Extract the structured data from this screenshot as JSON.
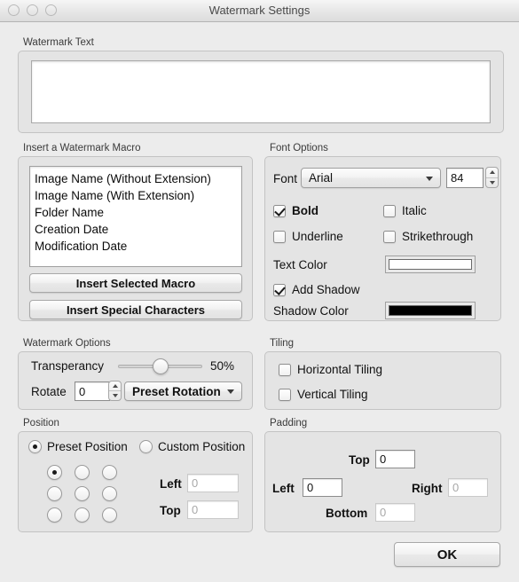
{
  "window": {
    "title": "Watermark Settings",
    "traffic_lights": [
      "close",
      "minimize",
      "zoom"
    ]
  },
  "watermark_text": {
    "label": "Watermark Text",
    "value": "",
    "placeholder": ""
  },
  "macro": {
    "group_label": "Insert a Watermark Macro",
    "items": [
      "Image Name (Without Extension)",
      "Image Name (With Extension)",
      "Folder Name",
      "Creation Date",
      "Modification Date"
    ],
    "insert_selected_label": "Insert Selected Macro",
    "insert_special_label": "Insert Special Characters"
  },
  "font_options": {
    "group_label": "Font Options",
    "font_label": "Font",
    "font_value": "Arial",
    "size_value": "84",
    "bold": {
      "label": "Bold",
      "checked": true
    },
    "italic": {
      "label": "Italic",
      "checked": false
    },
    "underline": {
      "label": "Underline",
      "checked": false
    },
    "strikethrough": {
      "label": "Strikethrough",
      "checked": false
    },
    "text_color_label": "Text Color",
    "text_color_value": "#ffffff",
    "add_shadow": {
      "label": "Add Shadow",
      "checked": true
    },
    "shadow_color_label": "Shadow Color",
    "shadow_color_value": "#000000"
  },
  "watermark_options": {
    "group_label": "Watermark Options",
    "transparency_label": "Transperancy",
    "transparency_value": "50%",
    "transparency_percent": 50,
    "rotate_label": "Rotate",
    "rotate_value": "0",
    "preset_rotation_value": "Preset Rotation"
  },
  "tiling": {
    "group_label": "Tiling",
    "horizontal": {
      "label": "Horizontal Tiling",
      "checked": false
    },
    "vertical": {
      "label": "Vertical Tiling",
      "checked": false
    }
  },
  "position": {
    "group_label": "Position",
    "preset_label": "Preset Position",
    "preset_selected": true,
    "custom_label": "Custom Position",
    "custom_selected": false,
    "grid_selected_index": 0,
    "left_label": "Left",
    "left_value": "0",
    "top_label": "Top",
    "top_value": "0"
  },
  "padding": {
    "group_label": "Padding",
    "top_label": "Top",
    "top_value": "0",
    "left_label": "Left",
    "left_value": "0",
    "right_label": "Right",
    "right_value": "0",
    "bottom_label": "Bottom",
    "bottom_value": "0"
  },
  "footer": {
    "ok_label": "OK"
  }
}
